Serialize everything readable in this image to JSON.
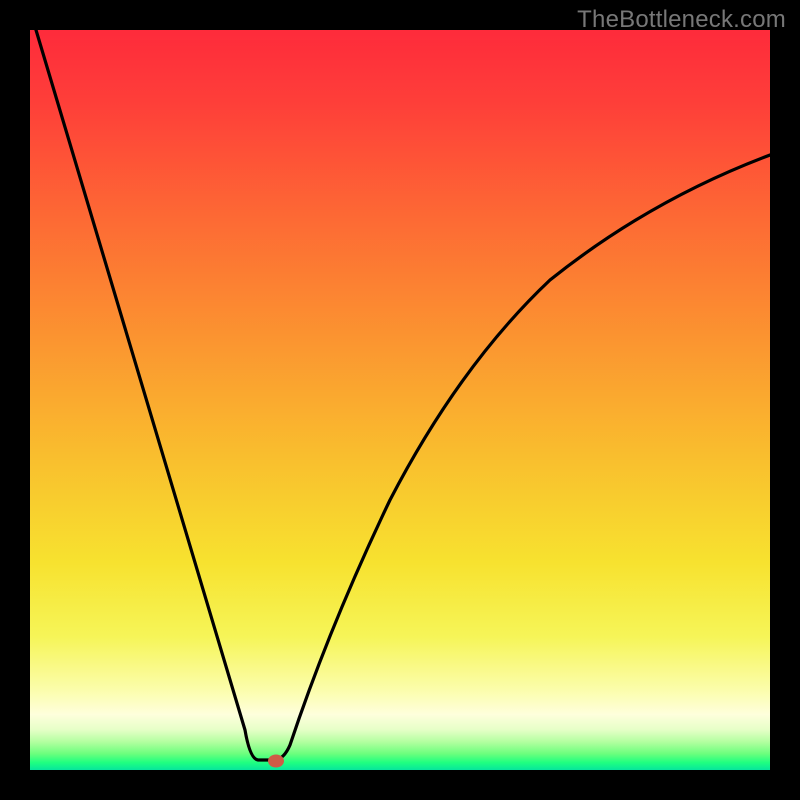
{
  "watermark": {
    "text": "TheBottleneck.com"
  },
  "chart_data": {
    "type": "line",
    "title": "",
    "xlabel": "",
    "ylabel": "",
    "xlim": [
      0,
      100
    ],
    "ylim": [
      0,
      100
    ],
    "grid": false,
    "legend": false,
    "background_gradient": {
      "orientation": "vertical",
      "stops": [
        {
          "pos": 0,
          "color": "#fe2b3b"
        },
        {
          "pos": 26,
          "color": "#fd6b34"
        },
        {
          "pos": 58,
          "color": "#f9bf2e"
        },
        {
          "pos": 82,
          "color": "#f6f558"
        },
        {
          "pos": 93,
          "color": "#feffdc"
        },
        {
          "pos": 97,
          "color": "#6cff7d"
        },
        {
          "pos": 100,
          "color": "#06e59d"
        }
      ]
    },
    "series": [
      {
        "name": "bottleneck-curve",
        "x": [
          0,
          5,
          10,
          15,
          20,
          25,
          28,
          30,
          31,
          32,
          33,
          34,
          36,
          40,
          45,
          50,
          55,
          60,
          65,
          70,
          75,
          80,
          85,
          90,
          95,
          100
        ],
        "y": [
          100,
          84,
          68,
          52,
          36,
          20,
          10,
          3,
          1,
          0,
          0,
          1,
          5,
          16,
          30,
          42,
          51,
          59,
          65,
          70,
          74,
          77,
          80,
          82,
          83,
          84
        ]
      }
    ],
    "minimum_marker": {
      "x": 32.5,
      "y": 0,
      "color": "#ce5b46"
    },
    "border": {
      "color": "#000",
      "thickness_px": 30
    }
  }
}
